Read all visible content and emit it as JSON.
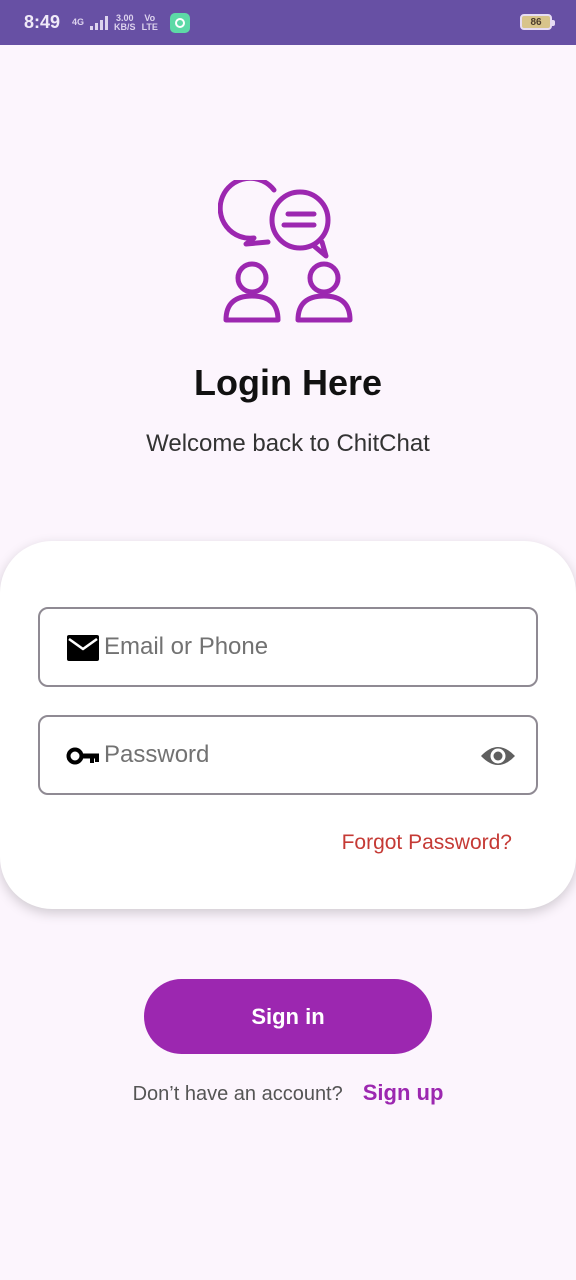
{
  "status_bar": {
    "time": "8:49",
    "network_type": "4G",
    "speed_value": "3.00",
    "speed_unit": "KB/S",
    "volte_top": "Vo",
    "volte_bottom": "LTE",
    "battery": "86"
  },
  "header": {
    "title": "Login Here",
    "subtitle": "Welcome back to ChitChat"
  },
  "form": {
    "email_placeholder": "Email or Phone",
    "email_value": "",
    "password_placeholder": "Password",
    "password_value": "",
    "forgot_label": "Forgot Password?"
  },
  "actions": {
    "signin_label": "Sign in",
    "signup_prompt": "Don’t have an account?",
    "signup_label": "Sign up"
  },
  "icons": {
    "logo": "chat-people-icon",
    "email": "mail-icon",
    "password": "key-icon",
    "visibility": "eye-icon"
  },
  "colors": {
    "status_bar": "#6750a4",
    "background": "#fcf5fd",
    "accent": "#9c27b0",
    "forgot_link": "#c53a35"
  }
}
